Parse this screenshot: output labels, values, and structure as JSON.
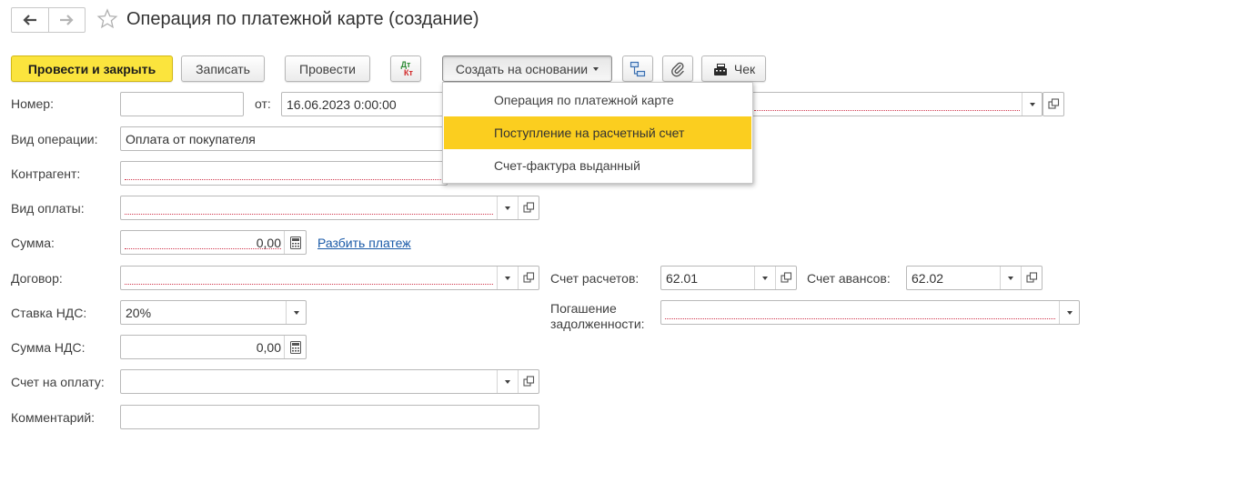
{
  "header": {
    "title": "Операция по платежной карте (создание)"
  },
  "toolbar": {
    "post_close_label": "Провести и закрыть",
    "save_label": "Записать",
    "post_label": "Провести",
    "dtkt_top": "Дт",
    "dtkt_bottom": "Кт",
    "create_based_label": "Создать на основании",
    "receipt_label": "Чек"
  },
  "dropdown_menu": {
    "items": [
      {
        "label": "Операция по платежной карте",
        "highlighted": false
      },
      {
        "label": "Поступление на расчетный счет",
        "highlighted": true
      },
      {
        "label": "Счет-фактура выданный",
        "highlighted": false
      }
    ]
  },
  "form": {
    "number": {
      "label": "Номер:",
      "value": ""
    },
    "date": {
      "label": "от:",
      "value": "16.06.2023  0:00:00"
    },
    "operation_type": {
      "label": "Вид операции:",
      "value": "Оплата от покупателя"
    },
    "counterparty": {
      "label": "Контрагент:",
      "value": ""
    },
    "payment_type": {
      "label": "Вид оплаты:",
      "value": ""
    },
    "amount": {
      "label": "Сумма:",
      "value": "0,00",
      "split_link": "Разбить платеж"
    },
    "contract": {
      "label": "Договор:",
      "value": ""
    },
    "settlement_account": {
      "label": "Счет расчетов:",
      "value": "62.01"
    },
    "advance_account": {
      "label": "Счет авансов:",
      "value": "62.02"
    },
    "vat_rate": {
      "label": "Ставка НДС:",
      "value": "20%"
    },
    "debt_repayment": {
      "label_line1": "Погашение",
      "label_line2": "задолженности:",
      "value": ""
    },
    "vat_amount": {
      "label": "Сумма НДС:",
      "value": "0,00"
    },
    "invoice": {
      "label": "Счет на оплату:",
      "value": ""
    },
    "comment": {
      "label": "Комментарий:",
      "value": ""
    }
  },
  "colors": {
    "primary_button": "#fbe43d",
    "menu_highlight": "#fbce1f",
    "link": "#1a5aa8",
    "required_underline": "#d0374d"
  }
}
